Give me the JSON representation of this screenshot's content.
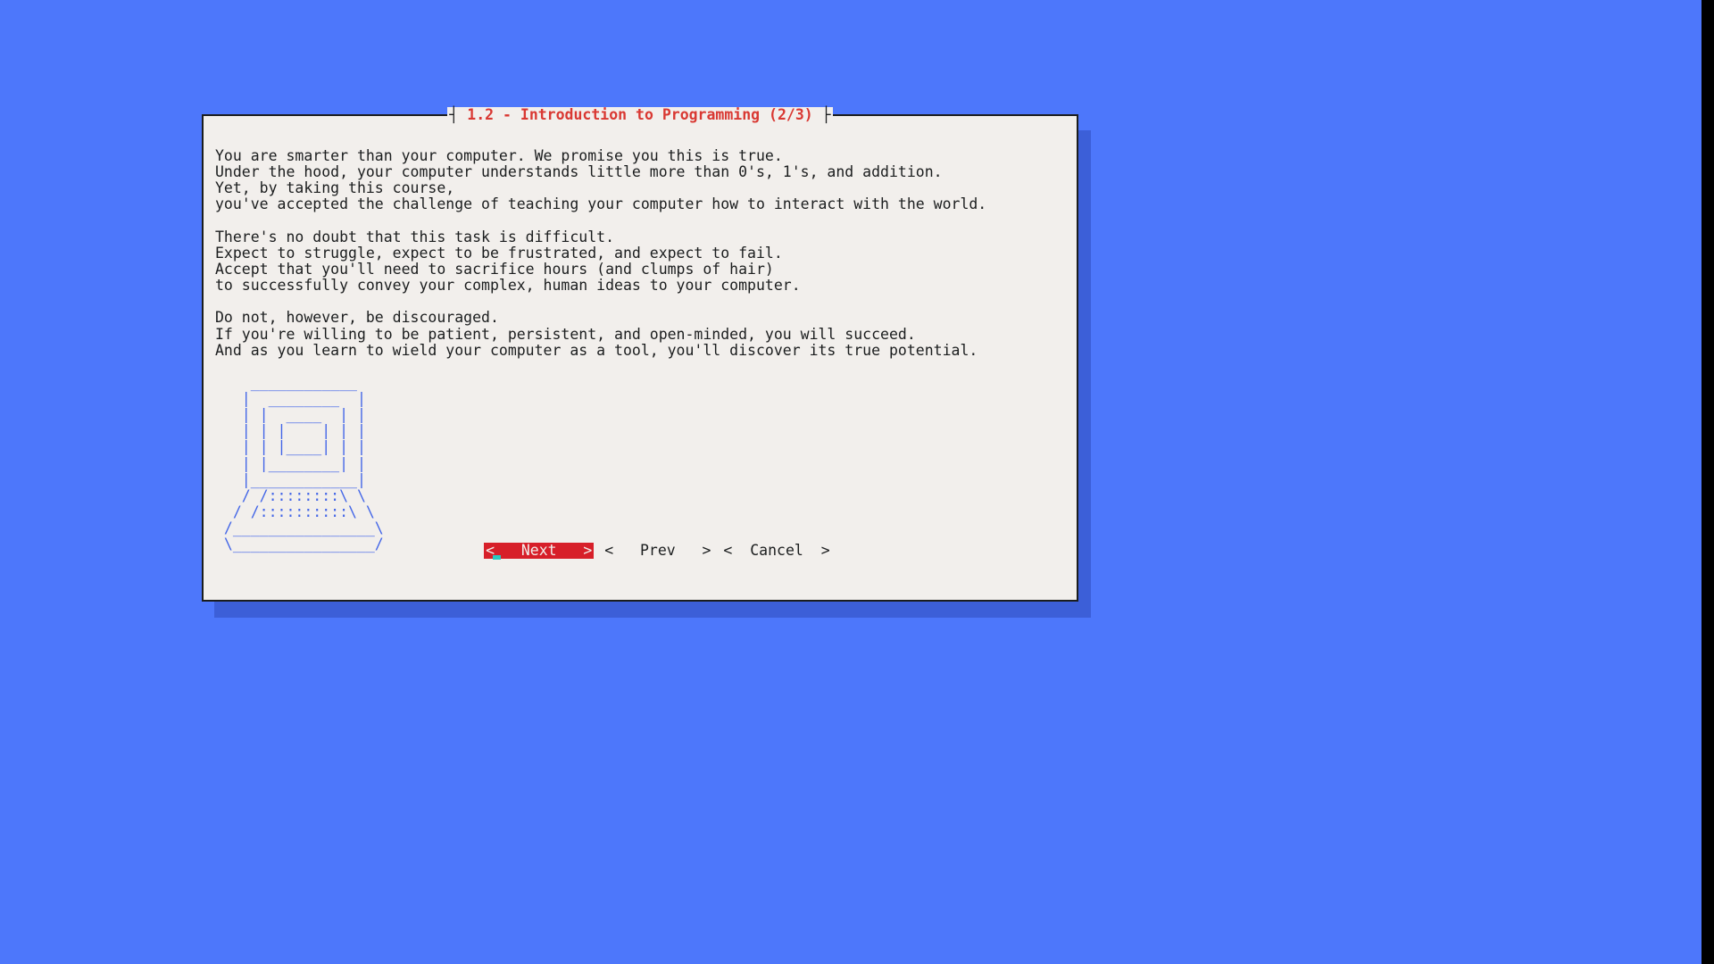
{
  "dialog": {
    "title": "1.2 - Introduction to Programming (2/3)",
    "body": "You are smarter than your computer. We promise you this is true.\nUnder the hood, your computer understands little more than 0's, 1's, and addition.\nYet, by taking this course,\nyou've accepted the challenge of teaching your computer how to interact with the world.\n\nThere's no doubt that this task is difficult.\nExpect to struggle, expect to be frustrated, and expect to fail.\nAccept that you'll need to sacrifice hours (and clumps of hair)\nto successfully convey your complex, human ideas to your computer.\n\nDo not, however, be discouraged.\nIf you're willing to be patient, persistent, and open-minded, you will succeed.\nAnd as you learn to wield your computer as a tool, you'll discover its true potential.",
    "ascii_art": "    ____________\n   |  ________  |\n   | |  ____  | |\n   | | |    | | |\n   | | |____| | |\n   | |________| |\n   |____________|\n   / /::::::::\\ \\\n  / /::::::::::\\ \\\n /________________\\\n \\________________/",
    "buttons": {
      "next": "<   Next   >",
      "prev": "<   Prev   >",
      "cancel": "<  Cancel  >"
    }
  },
  "colors": {
    "background": "#4d77fb",
    "panel": "#f2efec",
    "shadow": "#3c5fd8",
    "title": "#d93832",
    "selected_bg": "#d71f29",
    "ascii": "#4265e7",
    "cursor": "#2ac9bf"
  }
}
